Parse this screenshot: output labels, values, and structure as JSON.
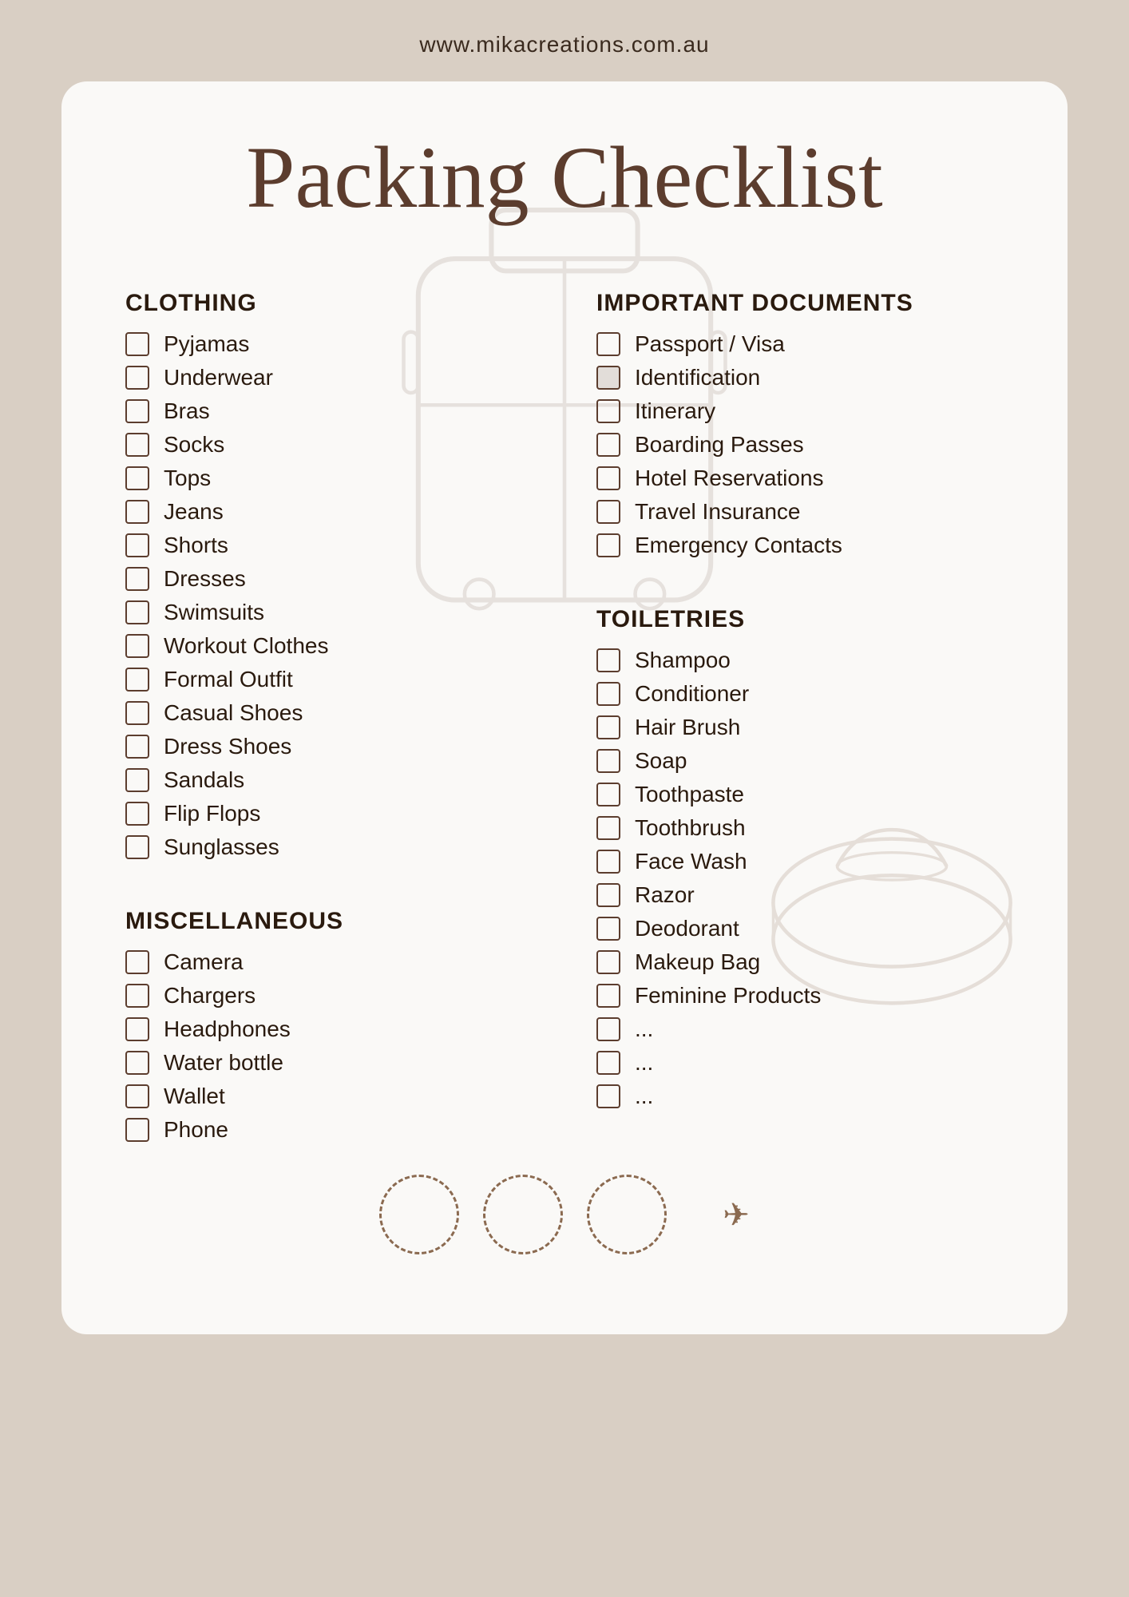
{
  "header": {
    "url": "www.mikacreations.com.au"
  },
  "title": "Packing Checklist",
  "sections": {
    "clothing": {
      "title": "CLOTHING",
      "items": [
        {
          "label": "Pyjamas",
          "checked": false
        },
        {
          "label": "Underwear",
          "checked": false
        },
        {
          "label": "Bras",
          "checked": false
        },
        {
          "label": "Socks",
          "checked": false
        },
        {
          "label": "Tops",
          "checked": false
        },
        {
          "label": "Jeans",
          "checked": false
        },
        {
          "label": "Shorts",
          "checked": false
        },
        {
          "label": "Dresses",
          "checked": false
        },
        {
          "label": "Swimsuits",
          "checked": false
        },
        {
          "label": "Workout Clothes",
          "checked": false
        },
        {
          "label": "Formal Outfit",
          "checked": false
        },
        {
          "label": "Casual Shoes",
          "checked": false
        },
        {
          "label": "Dress Shoes",
          "checked": false
        },
        {
          "label": "Sandals",
          "checked": false
        },
        {
          "label": "Flip Flops",
          "checked": false
        },
        {
          "label": "Sunglasses",
          "checked": false
        }
      ]
    },
    "miscellaneous": {
      "title": "MISCELLANEOUS",
      "items": [
        {
          "label": "Camera",
          "checked": false
        },
        {
          "label": "Chargers",
          "checked": false
        },
        {
          "label": "Headphones",
          "checked": false
        },
        {
          "label": "Water bottle",
          "checked": false
        },
        {
          "label": "Wallet",
          "checked": false
        },
        {
          "label": "Phone",
          "checked": false
        }
      ]
    },
    "important_documents": {
      "title": "IMPORTANT DOCUMENTS",
      "items": [
        {
          "label": "Passport / Visa",
          "checked": false
        },
        {
          "label": "Identification",
          "checked": true
        },
        {
          "label": "Itinerary",
          "checked": false
        },
        {
          "label": "Boarding Passes",
          "checked": false
        },
        {
          "label": "Hotel Reservations",
          "checked": false
        },
        {
          "label": "Travel Insurance",
          "checked": false
        },
        {
          "label": "Emergency Contacts",
          "checked": false
        }
      ]
    },
    "toiletries": {
      "title": "TOILETRIES",
      "items": [
        {
          "label": "Shampoo",
          "checked": false
        },
        {
          "label": "Conditioner",
          "checked": false
        },
        {
          "label": "Hair Brush",
          "checked": false
        },
        {
          "label": "Soap",
          "checked": false
        },
        {
          "label": "Toothpaste",
          "checked": false
        },
        {
          "label": "Toothbrush",
          "checked": false
        },
        {
          "label": "Face Wash",
          "checked": false
        },
        {
          "label": "Razor",
          "checked": false
        },
        {
          "label": "Deodorant",
          "checked": false
        },
        {
          "label": "Makeup Bag",
          "checked": false
        },
        {
          "label": "Feminine Products",
          "checked": false
        },
        {
          "label": "...",
          "checked": false
        },
        {
          "label": "...",
          "checked": false
        },
        {
          "label": "...",
          "checked": false
        }
      ]
    }
  },
  "colors": {
    "background": "#d9cfc4",
    "card": "#faf9f7",
    "text_dark": "#2a1a0e",
    "brown": "#5c3d2e",
    "accent": "#8b6a50"
  }
}
